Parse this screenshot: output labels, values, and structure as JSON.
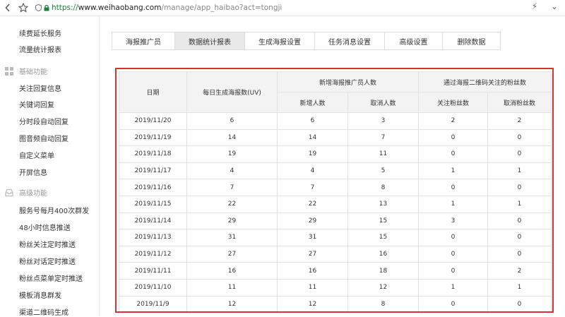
{
  "browser": {
    "url_scheme": "https://",
    "url_host": "www.weihaobang.com",
    "url_path": "/manage/app_haibao?act=tongji",
    "back_icon": "chevron-left-icon",
    "star_icon": "star-icon",
    "icons_right": [
      "lightning-icon",
      "chevron-down-icon"
    ]
  },
  "sidebar": {
    "top_items": [
      "续费延长服务",
      "流量统计报表"
    ],
    "groups": [
      {
        "title": "基础功能",
        "icon": "grid-icon",
        "items": [
          "关注回复信息",
          "关键词回复",
          "分时段自动回复",
          "图音频自动回复",
          "自定义菜单",
          "开屏信息"
        ]
      },
      {
        "title": "高级功能",
        "icon": "inbox-icon",
        "items": [
          "服务号每月400次群发",
          "48小时信息推送",
          "粉丝关注定时推送",
          "粉丝对话定时推送",
          "粉丝点菜单定时推送",
          "模板消息群发",
          "渠道二维码生成"
        ]
      }
    ]
  },
  "tabs": [
    {
      "label": "海报推广员",
      "active": false
    },
    {
      "label": "数据统计报表",
      "active": true
    },
    {
      "label": "生成海报设置",
      "active": false
    },
    {
      "label": "任务消息设置",
      "active": false
    },
    {
      "label": "高级设置",
      "active": false
    },
    {
      "label": "删除数据",
      "active": false
    }
  ],
  "table": {
    "col_date": "日期",
    "col_daily": "每日生成海报数(UV)",
    "group1": "新增海报推广员人数",
    "group2": "通过海报二维码关注的粉丝数",
    "sub1_new": "新增人数",
    "sub1_cancel": "取消人数",
    "sub2_follow": "关注粉丝数",
    "sub2_cancel": "取消粉丝数",
    "rows": [
      [
        "2019/11/20",
        "6",
        "6",
        "3",
        "2",
        "2"
      ],
      [
        "2019/11/19",
        "14",
        "14",
        "7",
        "0",
        "0"
      ],
      [
        "2019/11/18",
        "19",
        "19",
        "11",
        "0",
        "0"
      ],
      [
        "2019/11/17",
        "4",
        "4",
        "5",
        "1",
        "1"
      ],
      [
        "2019/11/16",
        "7",
        "7",
        "8",
        "0",
        "0"
      ],
      [
        "2019/11/15",
        "22",
        "22",
        "13",
        "1",
        "1"
      ],
      [
        "2019/11/14",
        "29",
        "29",
        "15",
        "3",
        "0"
      ],
      [
        "2019/11/13",
        "31",
        "31",
        "15",
        "0",
        "0"
      ],
      [
        "2019/11/12",
        "27",
        "27",
        "16",
        "0",
        "0"
      ],
      [
        "2019/11/11",
        "16",
        "16",
        "18",
        "0",
        "2"
      ],
      [
        "2019/11/10",
        "11",
        "11",
        "12",
        "1",
        "1"
      ],
      [
        "2019/11/9",
        "12",
        "12",
        "8",
        "0",
        "0"
      ]
    ]
  },
  "colors": {
    "highlight_border": "#d9312c",
    "active_tab": "#e9e9e9",
    "secure_green": "#1a7f37"
  }
}
